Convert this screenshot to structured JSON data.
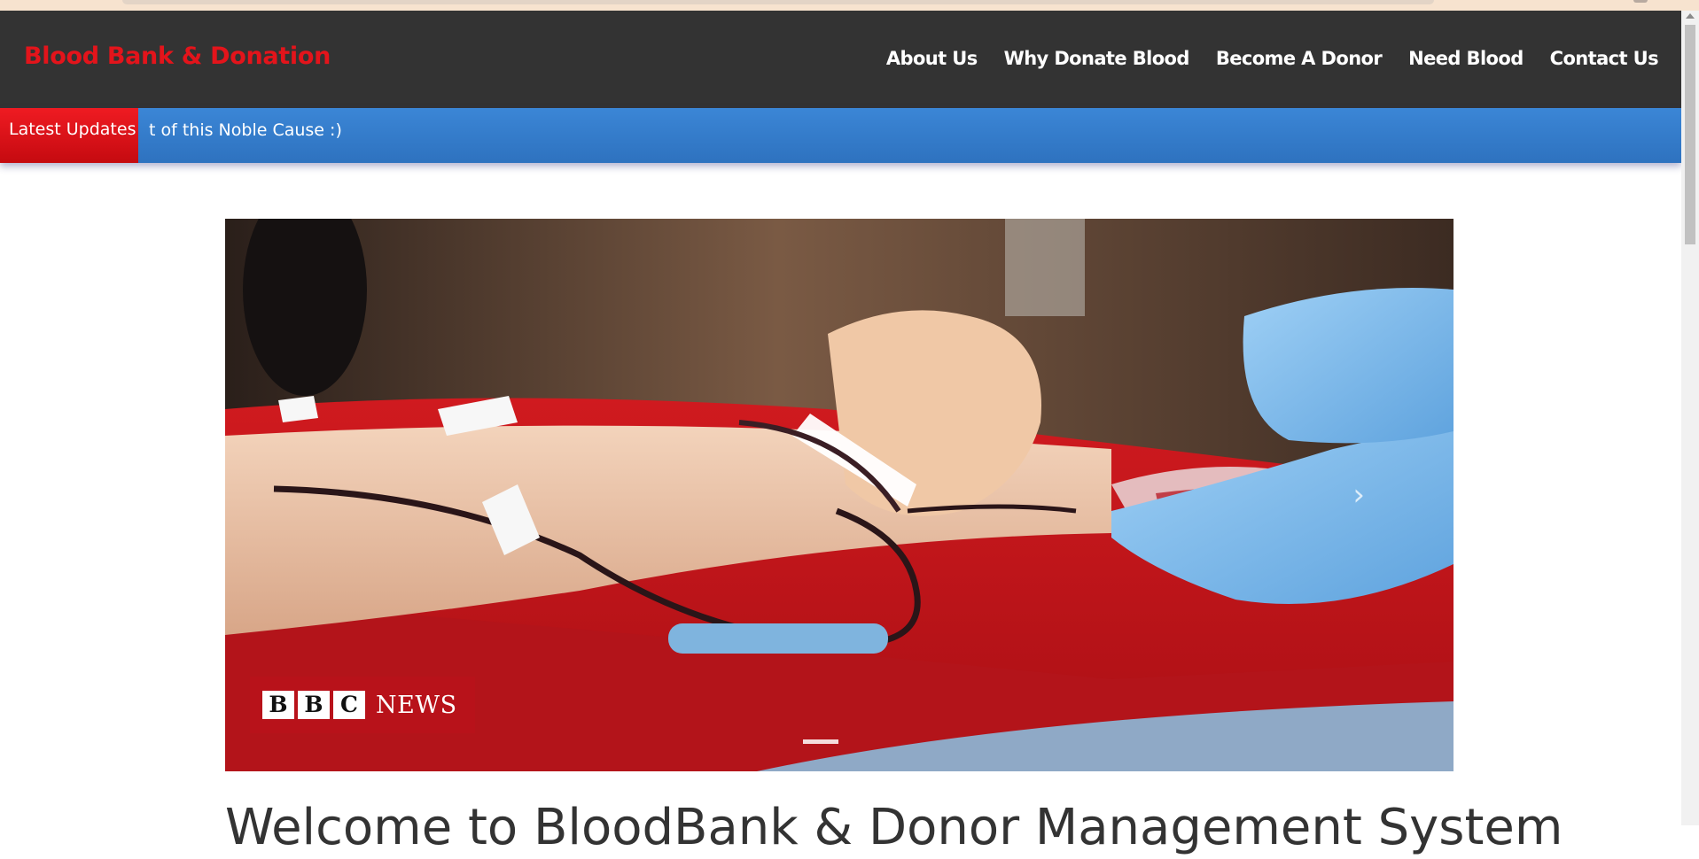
{
  "header": {
    "brand": "Blood Bank & Donation",
    "nav": [
      "About Us",
      "Why Donate Blood",
      "Become A Donor",
      "Need Blood",
      "Contact Us"
    ]
  },
  "updates": {
    "label": "Latest Updates",
    "ticker": "t of this Noble Cause :)"
  },
  "carousel": {
    "logo_blocks": [
      "B",
      "B",
      "C"
    ],
    "logo_news": "NEWS",
    "next_glyph": "›"
  },
  "main": {
    "heading": "Welcome to BloodBank & Donor Management System"
  },
  "colors": {
    "brand": "#e3141b",
    "navbar": "#333333",
    "ticker_bar": "#3b86d6",
    "label_red": "#ef1b22"
  }
}
